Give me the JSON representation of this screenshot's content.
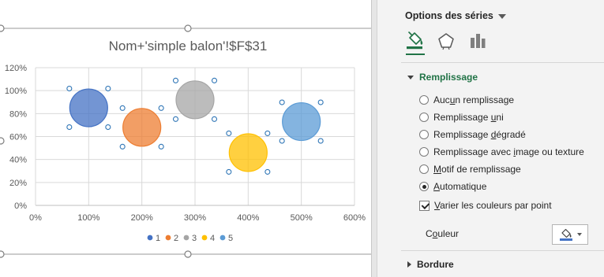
{
  "chart_data": {
    "type": "bubble",
    "title": "Nom+'simple balon'!$F$31",
    "xlim": [
      0,
      6
    ],
    "ylim": [
      0,
      1.2
    ],
    "x_ticks": [
      "0%",
      "100%",
      "200%",
      "300%",
      "400%",
      "500%",
      "600%"
    ],
    "y_ticks": [
      "0%",
      "20%",
      "40%",
      "60%",
      "80%",
      "100%",
      "120%"
    ],
    "grid": true,
    "legend_position": "bottom",
    "points": [
      {
        "name": "1",
        "x": 1.0,
        "y": 0.85,
        "color": "#4472C4"
      },
      {
        "name": "2",
        "x": 2.0,
        "y": 0.68,
        "color": "#ED7D31"
      },
      {
        "name": "3",
        "x": 3.0,
        "y": 0.92,
        "color": "#A5A5A5"
      },
      {
        "name": "4",
        "x": 4.0,
        "y": 0.46,
        "color": "#FFC000"
      },
      {
        "name": "5",
        "x": 5.0,
        "y": 0.73,
        "color": "#5B9BD5"
      }
    ]
  },
  "pane": {
    "header_label": "Options des séries",
    "tabs": [
      {
        "icon": "paint-bucket-icon"
      },
      {
        "icon": "pentagon-icon"
      },
      {
        "icon": "bar-chart-icon"
      }
    ],
    "fill_section_title": "Remplissage",
    "fill_options": [
      {
        "pre": "Auc",
        "key": "u",
        "post": "n remplissage",
        "checked": false
      },
      {
        "pre": "Remplissage ",
        "key": "u",
        "post": "ni",
        "checked": false
      },
      {
        "pre": "Remplissage ",
        "key": "d",
        "post": "égradé",
        "checked": false
      },
      {
        "pre": "Remplissage avec ",
        "key": "i",
        "post": "mage ou texture",
        "checked": false
      },
      {
        "pre": "",
        "key": "M",
        "post": "otif de remplissage",
        "checked": false
      },
      {
        "pre": "",
        "key": "A",
        "post": "utomatique",
        "checked": true
      }
    ],
    "vary_colors": {
      "pre": "",
      "key": "V",
      "post": "arier les couleurs par point",
      "checked": true
    },
    "color_pre": "C",
    "color_key": "o",
    "color_post": "uleur",
    "border_section_title": "Bordure",
    "colors": {
      "accent_green": "#217346",
      "swatch_blue": "#4472C4"
    }
  }
}
